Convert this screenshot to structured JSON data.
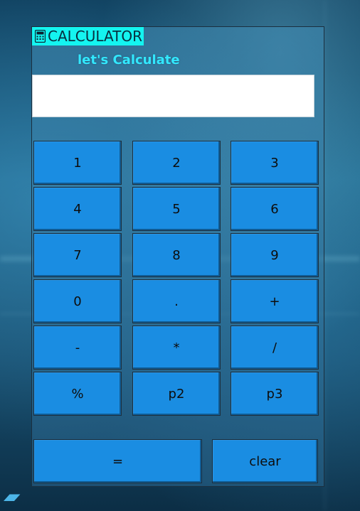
{
  "window": {
    "title": "CALCULATOR",
    "subtitle": "let's Calculate"
  },
  "display": {
    "value": ""
  },
  "keys": {
    "k1": "1",
    "k2": "2",
    "k3": "3",
    "k4": "4",
    "k5": "5",
    "k6": "6",
    "k7": "7",
    "k8": "8",
    "k9": "9",
    "k0": "0",
    "dot": ".",
    "plus": "+",
    "minus": "-",
    "mul": "*",
    "div": "/",
    "mod": "%",
    "p2": "p2",
    "p3": "p3",
    "eq": "=",
    "clear": "clear"
  },
  "colors": {
    "title_bar": "#14f4f0",
    "subtitle": "#32e8ff",
    "button": "#1a8de2",
    "display": "#ffffff"
  },
  "icons": {
    "title": "calculator-icon",
    "corner": "app-launcher-icon"
  }
}
